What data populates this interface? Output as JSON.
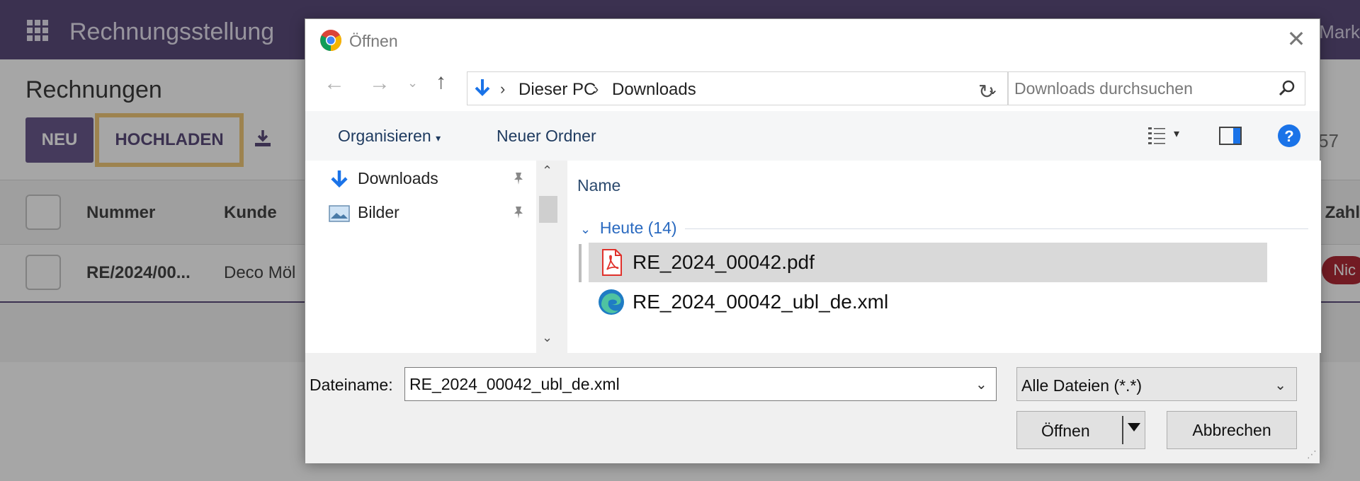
{
  "app": {
    "title": "Rechnungsstellung",
    "user_name": "Mark",
    "page_title": "Rechnungen",
    "new_label": "NEU",
    "upload_label": "HOCHLADEN",
    "pager_fragment": "57",
    "columns": {
      "number": "Nummer",
      "customer": "Kunde",
      "payment": "Zahl"
    },
    "row": {
      "number": "RE/2024/00...",
      "customer": "Deco Möl",
      "status": "Nic"
    },
    "colors": {
      "brand": "#5b4c7b",
      "highlight": "#f1c97a",
      "badge": "#b02a37"
    }
  },
  "dialog": {
    "title": "Öffnen",
    "icon": "chrome-icon",
    "breadcrumb": [
      "Dieser PC",
      "Downloads"
    ],
    "search_placeholder": "Downloads durchsuchen",
    "toolbar": {
      "organize": "Organisieren",
      "new_folder": "Neuer Ordner"
    },
    "nav_items": [
      {
        "label": "Downloads",
        "icon": "download-folder-icon"
      },
      {
        "label": "Bilder",
        "icon": "pictures-folder-icon"
      }
    ],
    "column_name": "Name",
    "group_label": "Heute (14)",
    "files": [
      {
        "name": "RE_2024_00042.pdf",
        "icon": "pdf-file-icon",
        "selected": true
      },
      {
        "name": "RE_2024_00042_ubl_de.xml",
        "icon": "edge-xml-file-icon",
        "selected": false
      }
    ],
    "filename_label": "Dateiname:",
    "filename_value": "RE_2024_00042_ubl_de.xml",
    "filter_value": "Alle Dateien (*.*)",
    "open_label": "Öffnen",
    "cancel_label": "Abbrechen"
  }
}
